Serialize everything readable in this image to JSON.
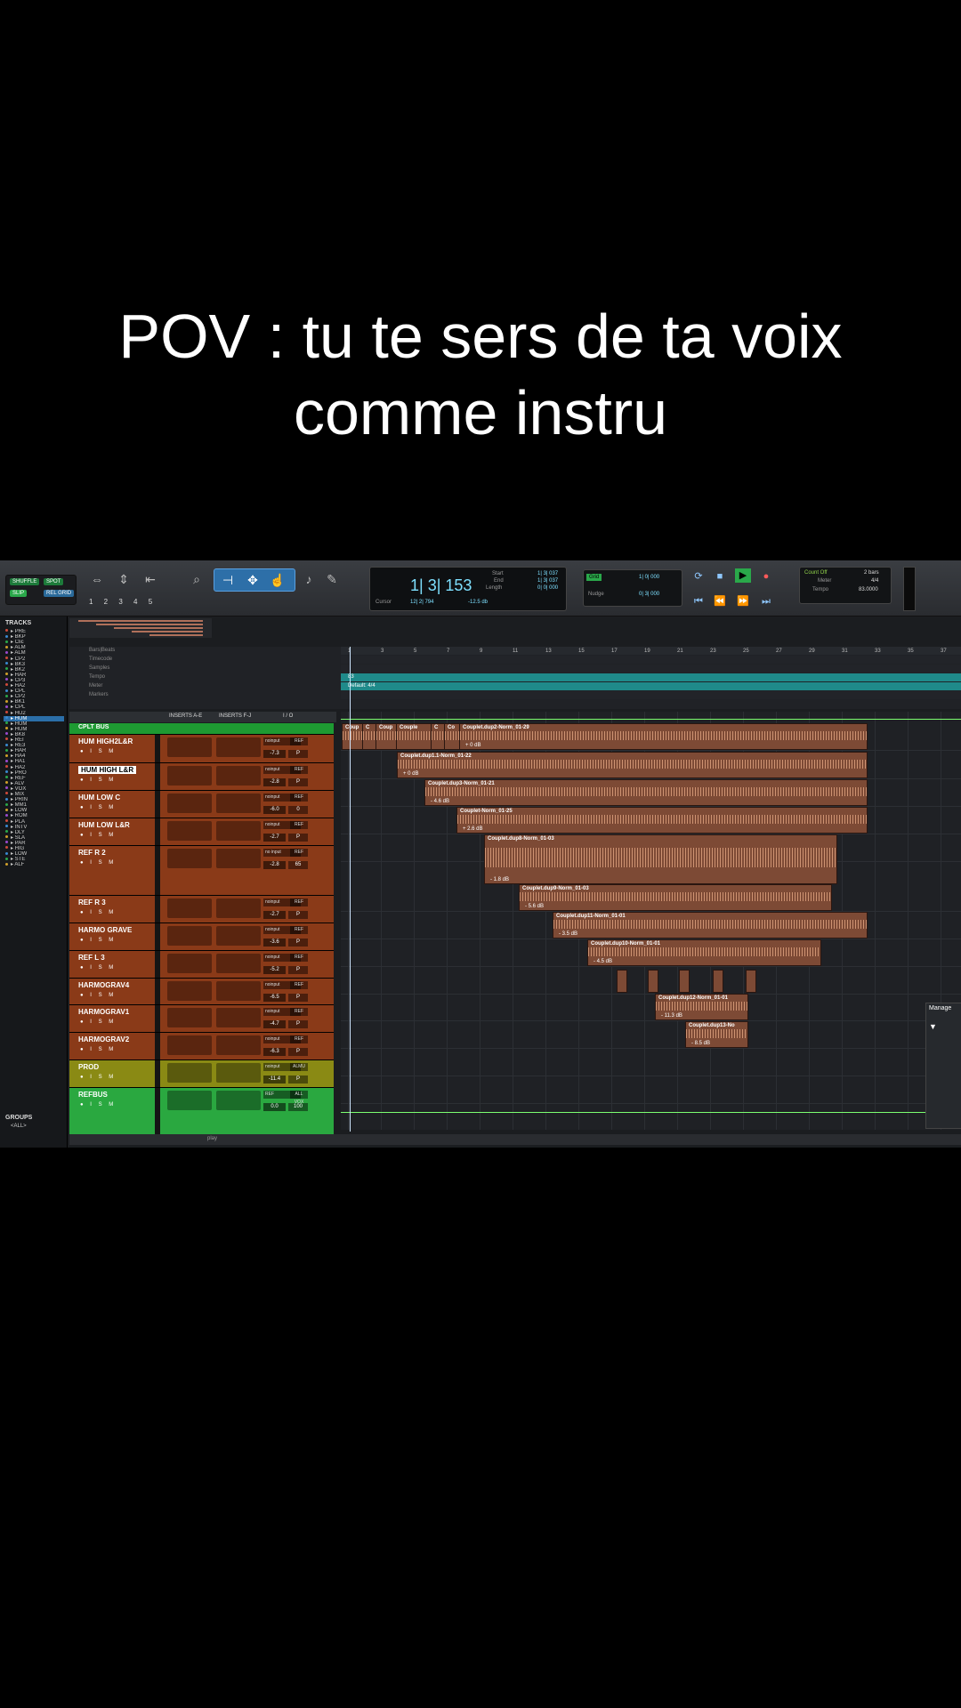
{
  "caption": {
    "line1": "POV : tu te sers de ta voix",
    "line2": "comme instru"
  },
  "toolbar": {
    "modes": [
      "SHUFFLE",
      "SPOT",
      "SLIP",
      "GRID"
    ],
    "grid_label": "REL GRID",
    "nums": "1 2 3 4 5",
    "counter_main": "1| 3| 153",
    "start_label": "Start",
    "start_val": "1| 3| 037",
    "end_label": "End",
    "end_val": "1| 3| 037",
    "length_label": "Length",
    "length_val": "0| 0| 000",
    "cursor_label": "Cursor",
    "cursor_val": "12| 2| 794",
    "cursor_db": "-12.5 db",
    "grid_tag": "Grid",
    "grid_val": "1| 0| 000",
    "nudge_label": "Nudge",
    "nudge_val": "0| 3| 000",
    "count_off": "Count Off",
    "bars": "2 bars",
    "meter_label": "Meter",
    "meter_val": "4/4",
    "tempo_label": "Tempo",
    "tempo_val": "83.0000"
  },
  "left_panel": {
    "tracks_title": "TRACKS",
    "tracks": [
      "PRE",
      "BKP",
      "Clic",
      "ALM",
      "ALM",
      "CP2",
      "BK3",
      "BK2",
      "HAR",
      "CP3",
      "HA2",
      "CPL",
      "CP2",
      "BK1",
      "CPL",
      "HU2",
      "HUM",
      "HUM",
      "HUM",
      "BK8",
      "REI",
      "RE3",
      "HAR",
      "HA4",
      "HA1",
      "HA2",
      "PRO",
      "REF",
      "ALV",
      "VOX",
      "MIX",
      "PRIN",
      "MM1",
      "LOW",
      "ROM",
      "PLA",
      "INTV",
      "DLY",
      "SLA",
      "PAR",
      "HIG",
      "LOW",
      "STE",
      "ALF"
    ],
    "selected_index": 16,
    "groups_title": "GROUPS",
    "groups_all": "<ALL>"
  },
  "rulers": [
    "Bars|Beats",
    "Timecode",
    "Samples",
    "Tempo",
    "Meter",
    "Markers"
  ],
  "bar_numbers": [
    "1",
    "3",
    "5",
    "7",
    "9",
    "11",
    "13",
    "15",
    "17",
    "19",
    "21",
    "23",
    "25",
    "27",
    "29",
    "31",
    "33",
    "35",
    "37"
  ],
  "tempo_marker": "83",
  "meter_marker": "Default: 4/4",
  "mix_header": {
    "inserts_ae": "INSERTS A-E",
    "inserts_fj": "INSERTS F-J",
    "io": "I / O"
  },
  "tracks": [
    {
      "name": "CPLT BUS",
      "color": "#1e9a32",
      "io": "",
      "vol": "",
      "pan": ""
    },
    {
      "name": "HUM HIGH2L&R",
      "color": "#8a3a18",
      "io": "noinput",
      "io2": "REF",
      "vol": "-7.3",
      "pan": "P"
    },
    {
      "name": "HUM HIGH L&R",
      "color": "#8a3a18",
      "io": "noinput",
      "io2": "REF",
      "vol": "-2.8",
      "pan": "P"
    },
    {
      "name": "HUM LOW C",
      "color": "#8a3a18",
      "io": "noinput",
      "io2": "REF",
      "vol": "-6.0",
      "pan": "0"
    },
    {
      "name": "HUM LOW L&R",
      "color": "#8a3a18",
      "io": "noinput",
      "io2": "REF",
      "vol": "-2.7",
      "pan": "P"
    },
    {
      "name": "REF R 2",
      "color": "#8a3a18",
      "io": "no input",
      "io2": "REF",
      "vol": "-2.8",
      "pan": "65"
    },
    {
      "name": "REF R 3",
      "color": "#8a3a18",
      "io": "noinput",
      "io2": "REF",
      "vol": "-2.7",
      "pan": "P"
    },
    {
      "name": "HARMO GRAVE",
      "color": "#8a3a18",
      "io": "noinput",
      "io2": "REF",
      "vol": "-3.6",
      "pan": "P"
    },
    {
      "name": "REF L 3",
      "color": "#8a3a18",
      "io": "noinput",
      "io2": "REF",
      "vol": "-5.2",
      "pan": "P"
    },
    {
      "name": "HARMOGRAV4",
      "color": "#8a3a18",
      "io": "noinput",
      "io2": "REF",
      "vol": "-6.5",
      "pan": "P"
    },
    {
      "name": "HARMOGRAV1",
      "color": "#8a3a18",
      "io": "noinput",
      "io2": "REF",
      "vol": "-4.7",
      "pan": "P"
    },
    {
      "name": "HARMOGRAV2",
      "color": "#8a3a18",
      "io": "noinput",
      "io2": "REF",
      "vol": "-6.3",
      "pan": "P"
    },
    {
      "name": "PROD",
      "color": "#8a8a14",
      "io": "noinput",
      "io2": "ALMU",
      "vol": "-11.4",
      "pan": "P"
    },
    {
      "name": "REFBUS",
      "color": "#2aa840",
      "io": "REF",
      "io2": "ALL VOX",
      "vol": "0.0",
      "pan": "100"
    }
  ],
  "clips": [
    {
      "label": "Coup",
      "row": 1
    },
    {
      "label": "C",
      "row": 1
    },
    {
      "label": "Coup",
      "row": 1
    },
    {
      "label": "Couple",
      "row": 1
    },
    {
      "label": "C",
      "row": 1
    },
    {
      "label": "Co",
      "row": 1
    },
    {
      "label": "Couplet.dup2-Norm_01-29",
      "row": 1,
      "gain": "+ 0 dB"
    },
    {
      "label": "Couplet.dup1.1-Norm_01-22",
      "row": 2,
      "gain": "+ 0 dB"
    },
    {
      "label": "Couplet.dup3-Norm_01-21",
      "row": 3,
      "gain": "- 4.6 dB"
    },
    {
      "label": "Couplet-Norm_01-25",
      "row": 4,
      "gain": "+ 2.6 dB"
    },
    {
      "label": "Couplet.dup8-Norm_01-03",
      "row": 5,
      "gain": "- 1.8 dB"
    },
    {
      "label": "Couplet.dup9-Norm_01-03",
      "row": 6,
      "gain": "- 5.6 dB"
    },
    {
      "label": "Couplet.dup11-Norm_01-01",
      "row": 7,
      "gain": "- 3.5 dB"
    },
    {
      "label": "Couplet.dup10-Norm_01-01",
      "row": 8,
      "gain": "- 4.5 dB"
    },
    {
      "label": "Couplet.dup12-Norm_01-01",
      "row": 10,
      "gain": "- 11.3 dB"
    },
    {
      "label": "Couplet.dup13-No",
      "row": 11,
      "gain": "- 8.5 dB"
    }
  ],
  "manage_label": "Manage",
  "bottom_label": "play"
}
